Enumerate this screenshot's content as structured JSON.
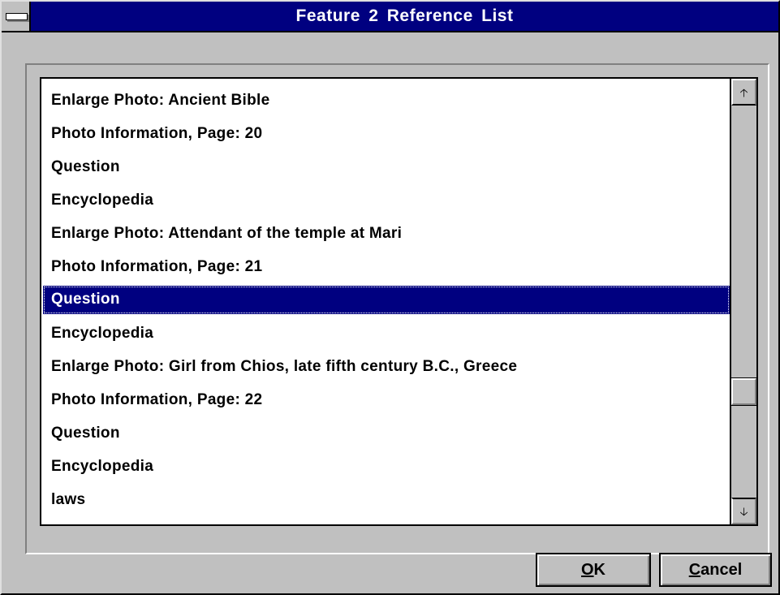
{
  "window": {
    "title": "Feature  2  Reference List",
    "system_menu_icon": "dash-icon"
  },
  "list": {
    "items": [
      {
        "label": "Enlarge Photo: Ancient Bible",
        "selected": false
      },
      {
        "label": "Photo Information, Page: 20",
        "selected": false
      },
      {
        "label": "Question",
        "selected": false
      },
      {
        "label": "Encyclopedia",
        "selected": false
      },
      {
        "label": "Enlarge Photo: Attendant of the temple at Mari",
        "selected": false
      },
      {
        "label": "Photo Information, Page: 21",
        "selected": false
      },
      {
        "label": "Question",
        "selected": true
      },
      {
        "label": "Encyclopedia",
        "selected": false
      },
      {
        "label": "Enlarge Photo: Girl from Chios, late fifth century B.C., Greece",
        "selected": false
      },
      {
        "label": "Photo Information, Page: 22",
        "selected": false
      },
      {
        "label": "Question",
        "selected": false
      },
      {
        "label": "Encyclopedia",
        "selected": false
      },
      {
        "label": "laws",
        "selected": false
      }
    ],
    "scroll_position": 0.75,
    "scroll_up_icon": "arrow-up-icon",
    "scroll_down_icon": "arrow-down-icon"
  },
  "buttons": {
    "ok": {
      "mnemonic": "O",
      "rest": "K"
    },
    "cancel": {
      "mnemonic": "C",
      "rest": "ancel"
    }
  },
  "colors": {
    "titlebar": "#000080",
    "selection": "#000080",
    "face": "#c0c0c0"
  }
}
